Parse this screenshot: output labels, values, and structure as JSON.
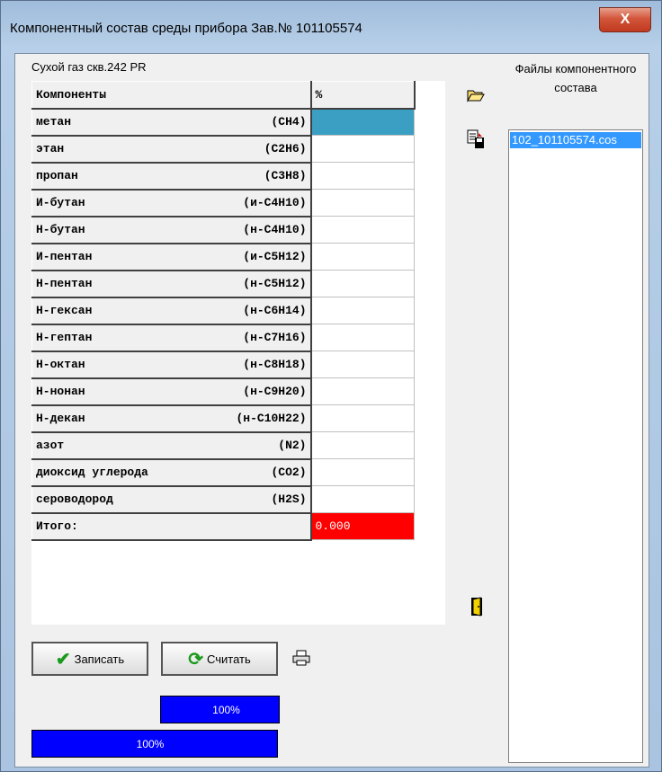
{
  "window": {
    "title": "Компонентный состав среды прибора Зав.№ 101105574",
    "close_glyph": "X"
  },
  "preset_label": "Сухой газ скв.242 PR",
  "grid": {
    "header_name": "Компоненты",
    "header_value": "%",
    "rows": [
      {
        "name": "метан",
        "formula": "(CH4)",
        "value": ""
      },
      {
        "name": "этан",
        "formula": "(C2H6)",
        "value": ""
      },
      {
        "name": "пропан",
        "formula": "(C3H8)",
        "value": ""
      },
      {
        "name": "И-бутан",
        "formula": "(и-C4H10)",
        "value": ""
      },
      {
        "name": "Н-бутан",
        "formula": "(н-C4H10)",
        "value": ""
      },
      {
        "name": "И-пентан",
        "formula": "(и-C5H12)",
        "value": ""
      },
      {
        "name": "Н-пентан",
        "formula": "(н-C5H12)",
        "value": ""
      },
      {
        "name": "Н-гексан",
        "formula": "(н-C6H14)",
        "value": ""
      },
      {
        "name": "Н-гептан",
        "formula": "(н-C7H16)",
        "value": ""
      },
      {
        "name": "Н-октан",
        "formula": "(н-C8H18)",
        "value": ""
      },
      {
        "name": "Н-нонан",
        "formula": "(н-C9H20)",
        "value": ""
      },
      {
        "name": "Н-декан",
        "formula": "(н-C10H22)",
        "value": ""
      },
      {
        "name": "азот",
        "formula": "(N2)",
        "value": ""
      },
      {
        "name": "диоксид углерода",
        "formula": "(CO2)",
        "value": ""
      },
      {
        "name": "сероводород",
        "formula": "(H2S)",
        "value": ""
      }
    ],
    "total_label": "Итого:",
    "total_value": "0.000"
  },
  "icons": {
    "open": "folder-open-icon",
    "save": "save-file-icon",
    "exit": "exit-door-icon",
    "print": "printer-icon"
  },
  "files": {
    "title": "Файлы компонентного состава",
    "items": [
      "102_101105574.cos"
    ]
  },
  "buttons": {
    "write_label": "Записать",
    "read_label": "Считать"
  },
  "progress": {
    "top": {
      "text": "100%",
      "value": 1.0
    },
    "bottom": {
      "text": "100%",
      "value": 1.0
    }
  },
  "colors": {
    "selected_cell": "#3b9fc4",
    "total_cell": "#ff0000",
    "progress_fill": "#0000ff",
    "list_selection": "#3399ff"
  }
}
